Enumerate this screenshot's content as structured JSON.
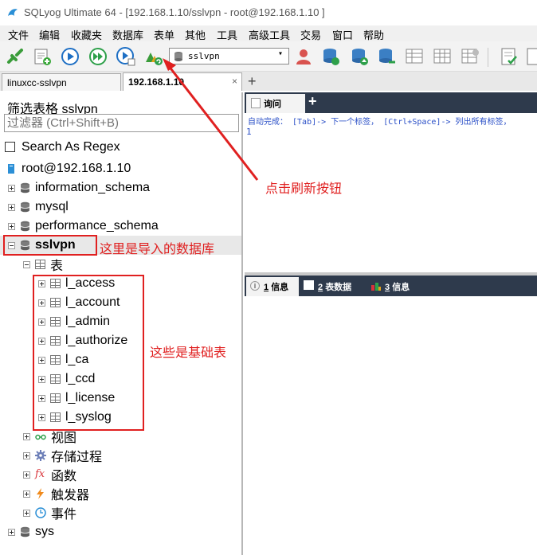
{
  "window": {
    "title": "SQLyog Ultimate 64 - [192.168.1.10/sslvpn - root@192.168.1.10 ]",
    "app_icon": "dolphin-icon"
  },
  "menu": [
    "文件",
    "编辑",
    "收藏夹",
    "数据库",
    "表单",
    "其他",
    "工具",
    "高级工具",
    "交易",
    "窗口",
    "帮助"
  ],
  "toolbar": {
    "db_selector": "sslvpn",
    "icons": [
      "connect-icon",
      "new-query-icon",
      "execute-icon",
      "execute-all-icon",
      "execute-edit-icon",
      "refresh-icon",
      "user-icon",
      "backup-icon",
      "restore-icon",
      "sync-icon",
      "schema-icon",
      "export-icon",
      "import-icon",
      "commit-icon",
      "rollback-icon"
    ]
  },
  "tabs": [
    {
      "label": "linuxcc-sslvpn",
      "active": false
    },
    {
      "label": "192.168.1.10",
      "active": true
    }
  ],
  "tab_add": "+",
  "tab_close": "×",
  "left": {
    "filter_label": "筛选表格 sslvpn",
    "filter_placeholder": "过滤器 (Ctrl+Shift+B)",
    "regex_label": "Search As Regex",
    "root": "root@192.168.1.10",
    "databases": [
      "information_schema",
      "mysql",
      "performance_schema"
    ],
    "selected_db": "sslvpn",
    "tables_folder": "表",
    "tables": [
      "l_access",
      "l_account",
      "l_admin",
      "l_authorize",
      "l_ca",
      "l_ccd",
      "l_license",
      "l_syslog"
    ],
    "folders": [
      "视图",
      "存储过程",
      "函数",
      "触发器",
      "事件"
    ],
    "last_db": "sys"
  },
  "annotations": {
    "refresh_note": "点击刷新按钮",
    "db_note": "这里是导入的数据库",
    "tables_note": "这些是基础表"
  },
  "query": {
    "tab_label": "询问",
    "add": "+",
    "hint": "自动完成： [Tab]-> 下一个标签， [Ctrl+Space]-> 列出所有标签，",
    "line_no": "1"
  },
  "results": {
    "tab1_num": "1",
    "tab1_label": "信息",
    "tab2_num": "2",
    "tab2_label": "表数据",
    "tab3_num": "3",
    "tab3_label": "信息"
  },
  "colors": {
    "annotation": "#e02020",
    "dark_bar": "#2e3a4c",
    "hint_text": "#2a4fc7"
  }
}
